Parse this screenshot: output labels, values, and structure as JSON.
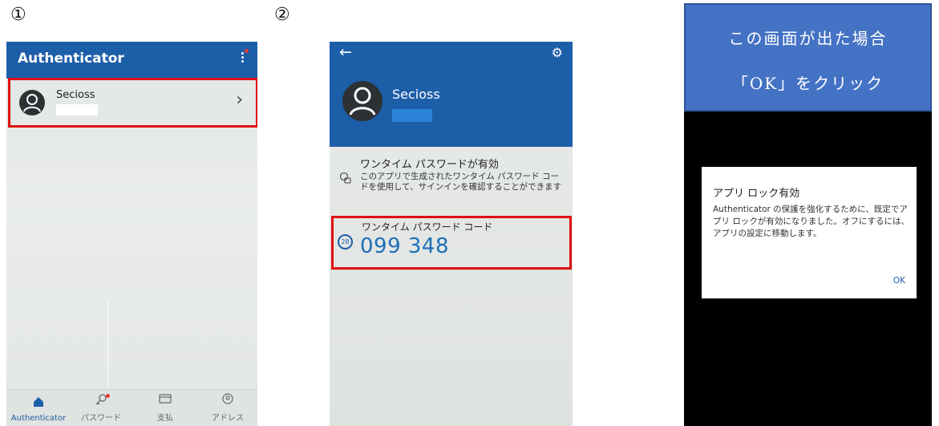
{
  "steps": {
    "one": "①",
    "two": "②"
  },
  "phone1": {
    "app_title": "Authenticator",
    "account_name": "Secioss",
    "nav": [
      {
        "label": "Authenticator",
        "icon": "home-icon"
      },
      {
        "label": "パスワード",
        "icon": "key-icon"
      },
      {
        "label": "支払",
        "icon": "card-icon"
      },
      {
        "label": "アドレス",
        "icon": "location-icon"
      }
    ]
  },
  "phone2": {
    "account_name": "Secioss",
    "info_title": "ワンタイム パスワードが有効",
    "info_desc": "このアプリで生成されたワンタイム パスワード コードを使用して、サインインを確認することができます",
    "code_label": "ワンタイム パスワード コード",
    "timer": "28",
    "code": "099 348"
  },
  "panel3": {
    "banner_line1": "この画面が出た場合",
    "banner_line2": "「OK」をクリック",
    "dialog_title": "アプリ ロック有効",
    "dialog_body": "Authenticator の保護を強化するために、既定でアプリ ロックが有効になりました。オフにするには、アプリの設定に移動します。",
    "dialog_ok": "OK"
  },
  "colors": {
    "brand_blue": "#1d5ea8",
    "highlight_red": "#e01010",
    "banner_blue": "#4472c4"
  }
}
